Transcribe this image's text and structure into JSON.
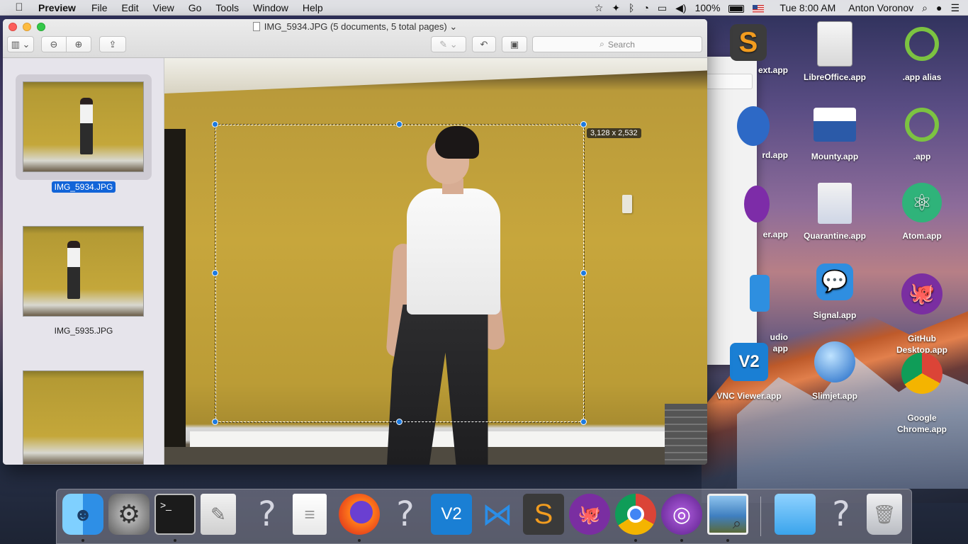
{
  "menubar": {
    "app": "Preview",
    "menus": [
      "File",
      "Edit",
      "View",
      "Go",
      "Tools",
      "Window",
      "Help"
    ],
    "battery": "100%",
    "clock": "Tue 8:00 AM",
    "user": "Anton Voronov"
  },
  "desktop_icons": [
    {
      "label": "ext.app",
      "icon": "sublime-text-icon"
    },
    {
      "label": "LibreOffice.app",
      "icon": "libreoffice-icon"
    },
    {
      "label": ".app alias",
      "icon": "app-alias-icon"
    },
    {
      "label": "rd.app",
      "icon": "app-icon"
    },
    {
      "label": "Mounty.app",
      "icon": "mounty-icon"
    },
    {
      "label": ".app",
      "icon": "app-icon"
    },
    {
      "label": "er.app",
      "icon": "app-icon"
    },
    {
      "label": "Quarantine.app",
      "icon": "quarantine-icon"
    },
    {
      "label": "Atom.app",
      "icon": "atom-icon"
    },
    {
      "label": "udio\napp",
      "icon": "app-icon"
    },
    {
      "label": "Signal.app",
      "icon": "signal-icon"
    },
    {
      "label": "GitHub\nDesktop.app",
      "icon": "github-icon"
    },
    {
      "label": "VNC Viewer.app",
      "icon": "vnc-icon"
    },
    {
      "label": "Slimjet.app",
      "icon": "slimjet-icon"
    },
    {
      "label": "Google\nChrome.app",
      "icon": "chrome-icon"
    }
  ],
  "window": {
    "title": "IMG_5934.JPG (5 documents, 5 total pages)",
    "search_placeholder": "Search",
    "crop_size": "3,128 x 2,532"
  },
  "sidebar": {
    "thumbnails": [
      {
        "label": "IMG_5934.JPG",
        "selected": true
      },
      {
        "label": "IMG_5935.JPG",
        "selected": false
      },
      {
        "label": "",
        "selected": false
      }
    ]
  },
  "dock": {
    "items": [
      "finder",
      "system-preferences",
      "terminal",
      "script-editor",
      "unknown",
      "textedit",
      "firefox",
      "unknown",
      "vnc-viewer",
      "vscode",
      "sublime-text",
      "github-desktop",
      "chrome",
      "tor-browser",
      "preview",
      "downloads-folder",
      "unknown",
      "trash"
    ]
  }
}
